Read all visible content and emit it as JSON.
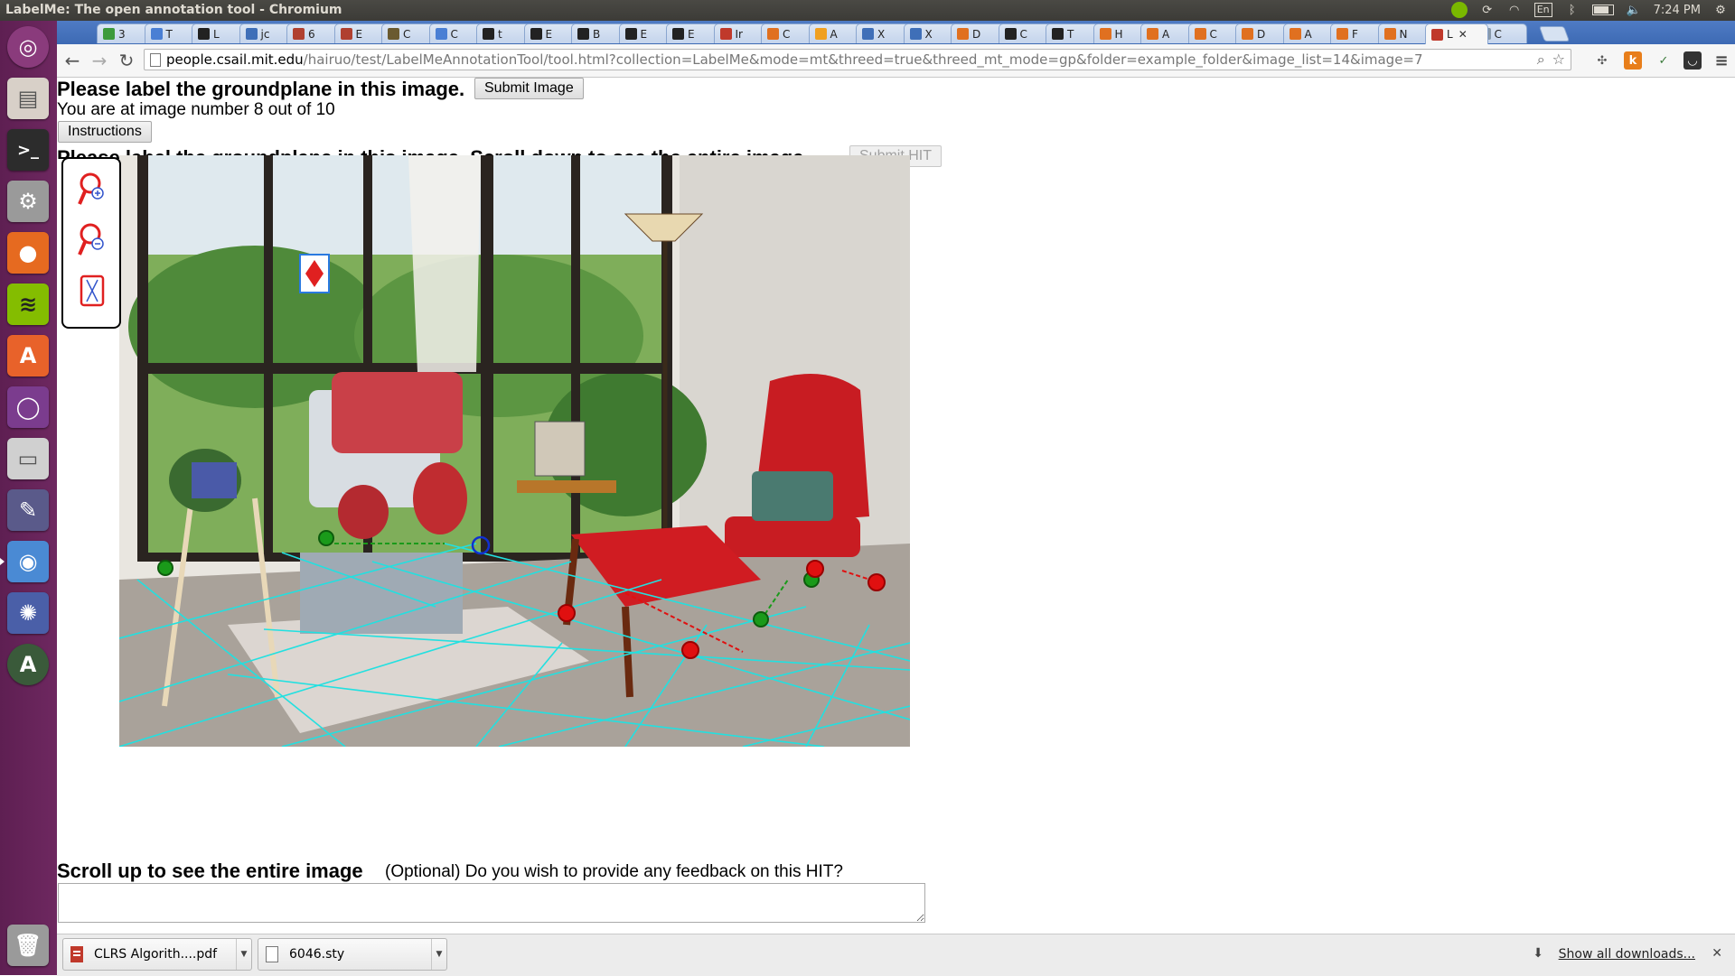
{
  "window": {
    "title": "LabelMe: The open annotation tool - Chromium"
  },
  "system_tray": {
    "keyboard": "En",
    "clock": "7:24 PM"
  },
  "tabs": [
    {
      "label": "3",
      "color": "#3c9a3c"
    },
    {
      "label": "T",
      "color": "#4a7fd4"
    },
    {
      "label": "L",
      "color": "#222222"
    },
    {
      "label": "jc",
      "color": "#3f6fb8"
    },
    {
      "label": "6",
      "color": "#b04030"
    },
    {
      "label": "E",
      "color": "#b04030"
    },
    {
      "label": "C",
      "color": "#6a5a30"
    },
    {
      "label": "C",
      "color": "#4a7fd4"
    },
    {
      "label": "t",
      "color": "#222222"
    },
    {
      "label": "E",
      "color": "#222222"
    },
    {
      "label": "B",
      "color": "#222222"
    },
    {
      "label": "E",
      "color": "#222222"
    },
    {
      "label": "E",
      "color": "#222222"
    },
    {
      "label": "Ir",
      "color": "#c0392b"
    },
    {
      "label": "C",
      "color": "#e07020"
    },
    {
      "label": "A",
      "color": "#f0a020"
    },
    {
      "label": "X",
      "color": "#3f6fb8"
    },
    {
      "label": "X",
      "color": "#3f6fb8"
    },
    {
      "label": "D",
      "color": "#e07020"
    },
    {
      "label": "C",
      "color": "#222222"
    },
    {
      "label": "T",
      "color": "#222222"
    },
    {
      "label": "H",
      "color": "#e07020"
    },
    {
      "label": "A",
      "color": "#e07020"
    },
    {
      "label": "C",
      "color": "#e07020"
    },
    {
      "label": "D",
      "color": "#e07020"
    },
    {
      "label": "A",
      "color": "#e07020"
    },
    {
      "label": "F",
      "color": "#e07020"
    },
    {
      "label": "N",
      "color": "#e07020"
    },
    {
      "label": "L",
      "color": "#c0392b",
      "active": true
    },
    {
      "label": "C",
      "color": "#8899aa"
    }
  ],
  "address": {
    "host": "people.csail.mit.edu",
    "path": "/hairuo/test/LabelMeAnnotationTool/tool.html?collection=LabelMe&mode=mt&threed=true&threed_mt_mode=gp&folder=example_folder&image_list=14&image=7"
  },
  "page": {
    "heading": "Please label the groundplane in this image.",
    "submit_image": "Submit Image",
    "progress_text": "You are at image number 8 out of 10",
    "instructions_button": "Instructions",
    "scroll_heading": "Please label the groundplane in this image. Scroll down to see the entire image.",
    "submit_hit": "Submit HIT",
    "bottom_heading": "Scroll up to see the entire image",
    "feedback_question": "(Optional) Do you wish to provide any feedback on this HIT?",
    "feedback_value": ""
  },
  "downloads": {
    "items": [
      {
        "name": "CLRS Algorith....pdf",
        "type": "pdf"
      },
      {
        "name": "6046.sty",
        "type": "file"
      }
    ],
    "show_all": "Show all downloads..."
  },
  "colors": {
    "grid_line": "#22e0e0",
    "green_point": "#1a9a1a",
    "red_point": "#e01010",
    "blue_point": "#1030d0",
    "launcher": "#6a2660"
  }
}
